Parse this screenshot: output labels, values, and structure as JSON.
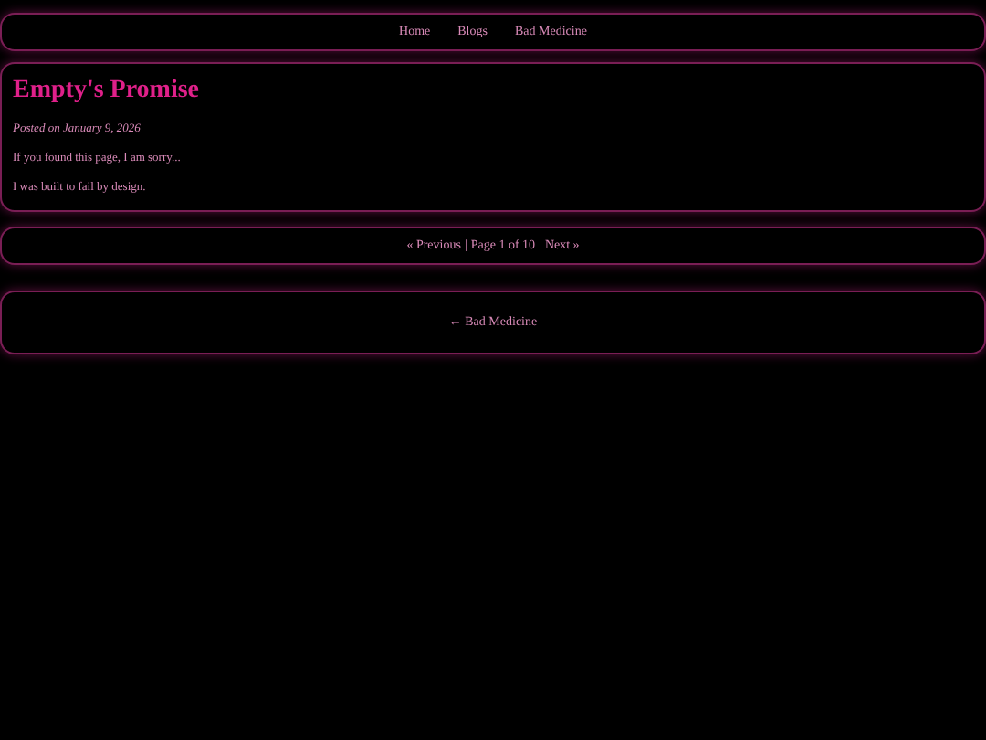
{
  "nav": {
    "links": [
      "Home",
      "Blogs",
      "Bad Medicine"
    ]
  },
  "post": {
    "title": "Empty's Promise",
    "meta": "Posted on January 9, 2026",
    "paragraphs": [
      "If you found this page, I am sorry...",
      "I was built to fail by design."
    ]
  },
  "pagination": {
    "previous": "« Previous",
    "separator_1": "|",
    "page": "Page 1 of 10",
    "separator_2": "|",
    "next": "Next »"
  },
  "back_link": "← Bad Medicine"
}
